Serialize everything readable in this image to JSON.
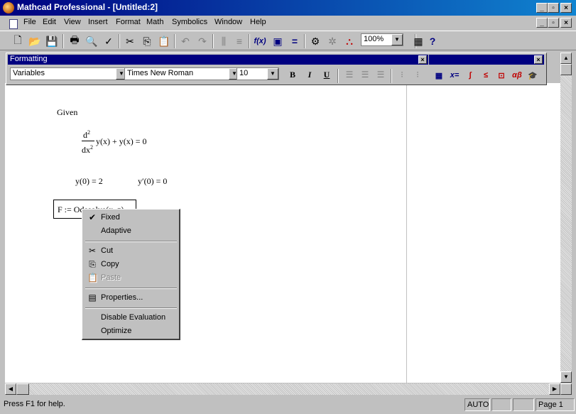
{
  "window": {
    "title": "Mathcad Professional - [Untitled:2]"
  },
  "menu": [
    "File",
    "Edit",
    "View",
    "Insert",
    "Format",
    "Math",
    "Symbolics",
    "Window",
    "Help"
  ],
  "toolbar": {
    "zoom": "100%"
  },
  "formatting": {
    "title": "Formatting",
    "style": "Variables",
    "font": "Times New Roman",
    "size": "10",
    "bold": "B",
    "italic": "I",
    "underline": "U"
  },
  "math": {
    "given": "Given",
    "eq_num": "d",
    "eq_num_sup": "2",
    "eq_den": "dx",
    "eq_den_sup": "2",
    "eq_rest": "y(x) + y(x) = 0",
    "ic1": "y(0) = 2",
    "ic2": "y′(0) = 0",
    "region": "F := Odesolve(x, z)"
  },
  "context_menu": {
    "fixed": "Fixed",
    "adaptive": "Adaptive",
    "cut": "Cut",
    "copy": "Copy",
    "paste": "Paste",
    "properties": "Properties...",
    "disable_eval": "Disable Evaluation",
    "optimize": "Optimize"
  },
  "status": {
    "help": "Press F1 for help.",
    "mode": "AUTO",
    "page": "Page 1"
  },
  "colors": {
    "title_bar": "#000080",
    "face": "#c0c0c0"
  }
}
